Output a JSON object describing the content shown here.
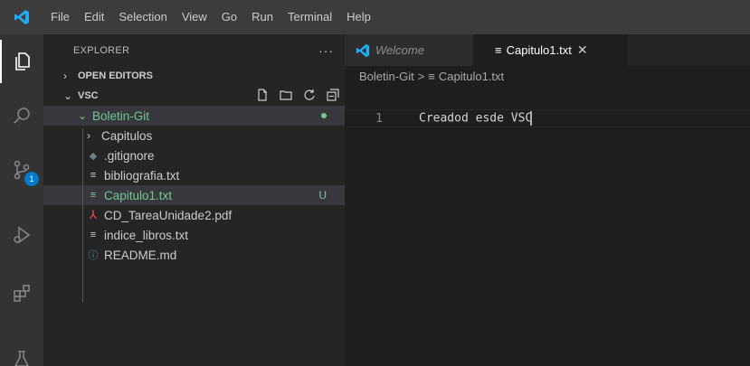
{
  "menu": [
    "File",
    "Edit",
    "Selection",
    "View",
    "Go",
    "Run",
    "Terminal",
    "Help"
  ],
  "activity": {
    "scm_badge": "1"
  },
  "sidebar": {
    "title": "EXPLORER",
    "more": "···",
    "open_editors": "OPEN EDITORS",
    "workspace": "VSC",
    "folder": "Boletin-Git",
    "items": [
      {
        "label": "Capitulos",
        "type": "folder"
      },
      {
        "label": ".gitignore",
        "type": "gitignore"
      },
      {
        "label": "bibliografia.txt",
        "type": "txt"
      },
      {
        "label": "Capitulo1.txt",
        "type": "txt",
        "status": "U"
      },
      {
        "label": "CD_TareaUnidade2.pdf",
        "type": "pdf"
      },
      {
        "label": "indice_libros.txt",
        "type": "txt"
      },
      {
        "label": "README.md",
        "type": "md"
      }
    ]
  },
  "tabs": [
    {
      "label": "Welcome",
      "active": false
    },
    {
      "label": "Capitulo1.txt",
      "active": true,
      "close": "✕"
    }
  ],
  "breadcrumb": {
    "folder": "Boletin-Git",
    "separator": ">",
    "file": "Capitulo1.txt"
  },
  "editor": {
    "lines": [
      {
        "number": "1",
        "text": "Creadod esde VSC"
      }
    ]
  },
  "colors": {
    "accent": "#007acc",
    "git_untracked": "#73c991",
    "pdf_icon": "#f14c4c",
    "vscode_logo": "#23a9f2"
  }
}
